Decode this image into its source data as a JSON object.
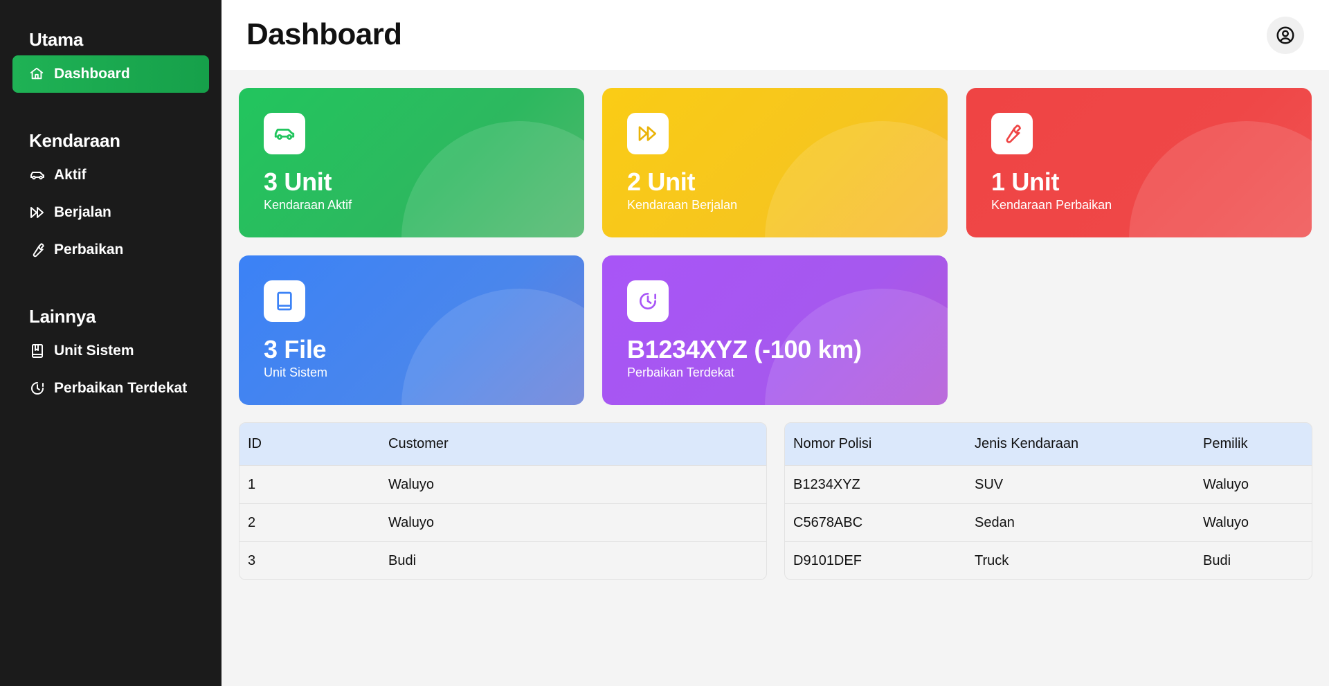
{
  "sidebar": {
    "sections": [
      {
        "title": "Utama",
        "items": [
          {
            "label": "Dashboard",
            "icon": "home-icon",
            "active": true
          }
        ]
      },
      {
        "title": "Kendaraan",
        "items": [
          {
            "label": "Aktif",
            "icon": "car-icon"
          },
          {
            "label": "Berjalan",
            "icon": "fast-forward-icon"
          },
          {
            "label": "Perbaikan",
            "icon": "wrench-icon"
          }
        ]
      },
      {
        "title": "Lainnya",
        "items": [
          {
            "label": "Unit Sistem",
            "icon": "book-icon"
          },
          {
            "label": "Perbaikan Terdekat",
            "icon": "clock-alert-icon"
          }
        ]
      }
    ]
  },
  "header": {
    "title": "Dashboard",
    "profile_icon": "user-circle-icon"
  },
  "cards": [
    {
      "value": "3 Unit",
      "label": "Kendaraan Aktif",
      "icon": "car-icon",
      "color": "#22c55e"
    },
    {
      "value": "2 Unit",
      "label": "Kendaraan Berjalan",
      "icon": "fast-forward-icon",
      "color": "#facc15"
    },
    {
      "value": "1 Unit",
      "label": "Kendaraan Perbaikan",
      "icon": "wrench-icon",
      "color": "#ef4444"
    },
    {
      "value": "3 File",
      "label": "Unit Sistem",
      "icon": "book-icon",
      "color": "#3b82f6"
    },
    {
      "value": "B1234XYZ (-100 km)",
      "label": "Perbaikan Terdekat",
      "icon": "clock-alert-icon",
      "color": "#a855f7"
    }
  ],
  "customers_table": {
    "columns": [
      "ID",
      "Customer"
    ],
    "rows": [
      [
        "1",
        "Waluyo"
      ],
      [
        "2",
        "Waluyo"
      ],
      [
        "3",
        "Budi"
      ]
    ]
  },
  "vehicles_table": {
    "columns": [
      "Nomor Polisi",
      "Jenis Kendaraan",
      "Pemilik"
    ],
    "rows": [
      [
        "B1234XYZ",
        "SUV",
        "Waluyo"
      ],
      [
        "C5678ABC",
        "Sedan",
        "Waluyo"
      ],
      [
        "D9101DEF",
        "Truck",
        "Budi"
      ]
    ]
  },
  "colors": {
    "sidebar_bg": "#1b1b1b",
    "active_item": "#16a34a",
    "table_header": "#dbe8fb",
    "page_bg": "#f4f4f4"
  }
}
